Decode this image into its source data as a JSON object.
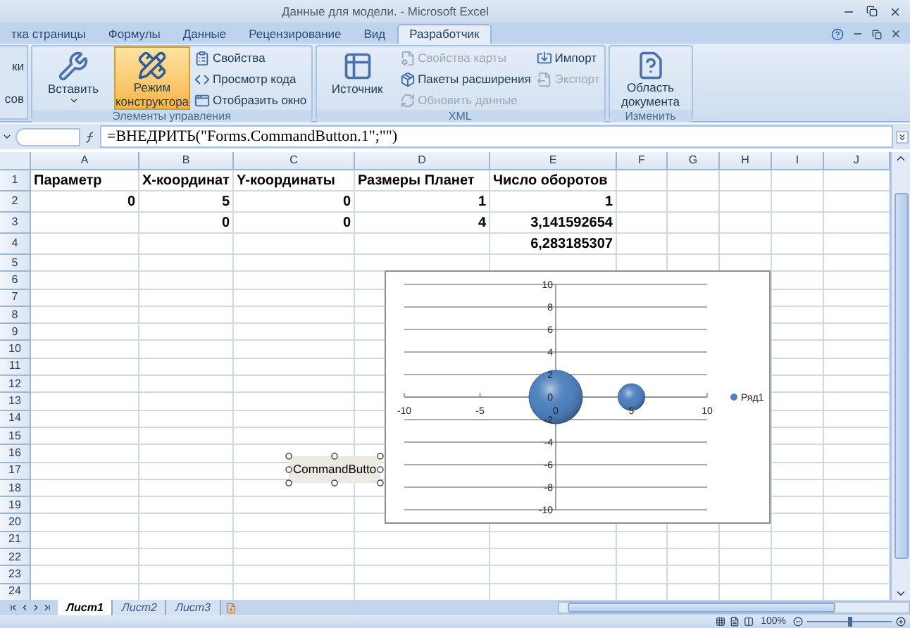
{
  "window": {
    "title": "Данные для модели. - Microsoft Excel"
  },
  "ribbon_tabs": [
    {
      "label": "тка страницы",
      "selected": false
    },
    {
      "label": "Формулы",
      "selected": false
    },
    {
      "label": "Данные",
      "selected": false
    },
    {
      "label": "Рецензирование",
      "selected": false
    },
    {
      "label": "Вид",
      "selected": false
    },
    {
      "label": "Разработчик",
      "selected": true
    }
  ],
  "ribbon": {
    "cut_group": {
      "lines": [
        "ки",
        "сов"
      ]
    },
    "groups": [
      {
        "label": "Элементы управления",
        "items": [
          {
            "label": "Вставить",
            "kind": "large-menu",
            "active": false,
            "disabled": false
          },
          {
            "label": "Режим конструктора",
            "kind": "large",
            "active": true,
            "disabled": false
          },
          {
            "label": "Свойства",
            "kind": "small",
            "active": false,
            "disabled": false
          },
          {
            "label": "Просмотр кода",
            "kind": "small",
            "active": false,
            "disabled": false
          },
          {
            "label": "Отобразить окно",
            "kind": "small",
            "active": false,
            "disabled": false
          }
        ]
      },
      {
        "label": "XML",
        "items": [
          {
            "label": "Источник",
            "kind": "large",
            "active": false,
            "disabled": false
          },
          {
            "label": "Свойства карты",
            "kind": "small",
            "active": false,
            "disabled": true
          },
          {
            "label": "Пакеты расширения",
            "kind": "small",
            "active": false,
            "disabled": false
          },
          {
            "label": "Обновить данные",
            "kind": "small",
            "active": false,
            "disabled": true
          },
          {
            "label": "Импорт",
            "kind": "small",
            "active": false,
            "disabled": false
          },
          {
            "label": "Экспорт",
            "kind": "small",
            "active": false,
            "disabled": true
          }
        ]
      },
      {
        "label": "Изменить",
        "items": [
          {
            "label": "Область документа",
            "kind": "large",
            "active": false,
            "disabled": false
          }
        ]
      }
    ]
  },
  "formula_bar": {
    "formula": "=ВНЕДРИТЬ(\"Forms.CommandButton.1\";\"\")"
  },
  "sheet": {
    "columns": [
      "A",
      "B",
      "C",
      "D",
      "E",
      "F",
      "G",
      "H",
      "I",
      "J"
    ],
    "rows": [
      {
        "header": "1",
        "cells": [
          {
            "text": "Параметр",
            "kind": "text"
          },
          {
            "text": "X-координат",
            "kind": "text"
          },
          {
            "text": "Y-координаты",
            "kind": "text"
          },
          {
            "text": "Размеры Планет",
            "kind": "text"
          },
          {
            "text": "Число оборотов",
            "kind": "text"
          },
          null,
          null,
          null,
          null,
          null
        ]
      },
      {
        "header": "2",
        "cells": [
          {
            "text": "0",
            "kind": "number"
          },
          {
            "text": "5",
            "kind": "number"
          },
          {
            "text": "0",
            "kind": "number"
          },
          {
            "text": "1",
            "kind": "number"
          },
          {
            "text": "1",
            "kind": "number"
          },
          null,
          null,
          null,
          null,
          null
        ]
      },
      {
        "header": "3",
        "cells": [
          null,
          {
            "text": "0",
            "kind": "number"
          },
          {
            "text": "0",
            "kind": "number"
          },
          {
            "text": "4",
            "kind": "number"
          },
          {
            "text": "3,141592654",
            "kind": "number"
          },
          null,
          null,
          null,
          null,
          null
        ]
      },
      {
        "header": "4",
        "cells": [
          null,
          null,
          null,
          null,
          {
            "text": "6,283185307",
            "kind": "number"
          },
          null,
          null,
          null,
          null,
          null
        ]
      },
      {
        "header": "5"
      },
      {
        "header": "6"
      },
      {
        "header": "7"
      },
      {
        "header": "8"
      },
      {
        "header": "9"
      },
      {
        "header": "10"
      },
      {
        "header": "11"
      },
      {
        "header": "12"
      },
      {
        "header": "13"
      },
      {
        "header": "14"
      },
      {
        "header": "15"
      },
      {
        "header": "16"
      },
      {
        "header": "17"
      },
      {
        "header": "18"
      },
      {
        "header": "19"
      },
      {
        "header": "20"
      },
      {
        "header": "21"
      },
      {
        "header": "22"
      },
      {
        "header": "23"
      },
      {
        "header": "24"
      }
    ]
  },
  "command_button": {
    "label": "CommandButto",
    "selected": true
  },
  "chart": {
    "chart_data": {
      "type": "scatter",
      "x": [
        5,
        0
      ],
      "series": [
        {
          "name": "Ряд1",
          "color": "#4f81bd",
          "values": [
            0,
            0
          ]
        }
      ],
      "grid": true,
      "xlim": [
        -10,
        10
      ],
      "ylim": [
        -10,
        10
      ],
      "xticks": [
        -10,
        -5,
        0,
        5,
        10
      ],
      "yticks": [
        -10,
        -8,
        -6,
        -4,
        -2,
        0,
        2,
        4,
        6,
        8,
        10
      ]
    }
  },
  "sheet_tabs": [
    {
      "label": "Лист1",
      "selected": true
    },
    {
      "label": "Лист2",
      "selected": false
    },
    {
      "label": "Лист3",
      "selected": false
    }
  ],
  "status_bar": {
    "zoom": "100%",
    "zoom_slider": {
      "level": 0.5
    }
  }
}
